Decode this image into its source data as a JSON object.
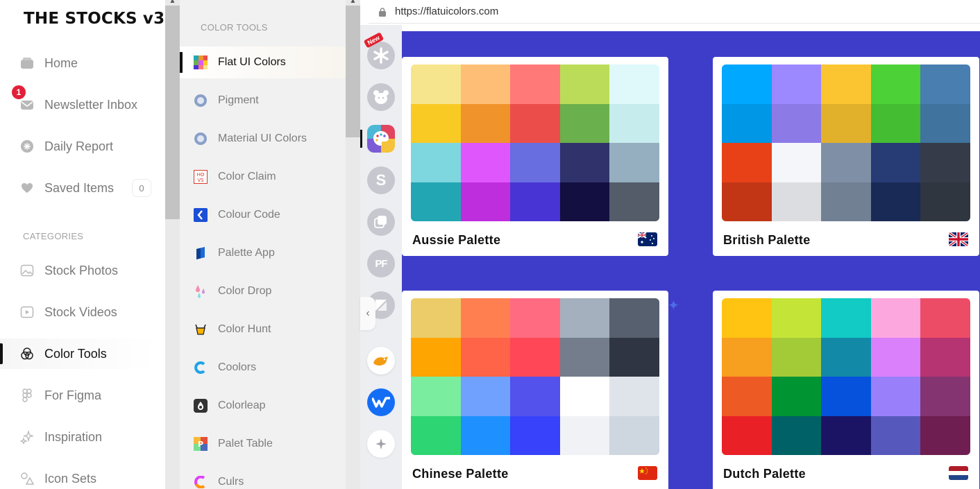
{
  "app": {
    "title": "THE STOCKS v3"
  },
  "sidebar": {
    "items": [
      {
        "label": "Home",
        "icon": "home-icon"
      },
      {
        "label": "Newsletter Inbox",
        "icon": "inbox-icon",
        "badge": "1"
      },
      {
        "label": "Daily Report",
        "icon": "report-icon"
      },
      {
        "label": "Saved Items",
        "icon": "heart-icon",
        "count": "0"
      }
    ],
    "categories_title": "CATEGORIES",
    "categories": [
      {
        "label": "Stock Photos",
        "icon": "photo-icon"
      },
      {
        "label": "Stock Videos",
        "icon": "video-icon"
      },
      {
        "label": "Color Tools",
        "icon": "palette-icon",
        "active": true
      },
      {
        "label": "For Figma",
        "icon": "figma-icon"
      },
      {
        "label": "Inspiration",
        "icon": "sparkle-icon"
      },
      {
        "label": "Icon Sets",
        "icon": "shapes-icon"
      }
    ]
  },
  "tools": {
    "title": "COLOR TOOLS",
    "items": [
      {
        "label": "Flat UI Colors",
        "active": true
      },
      {
        "label": "Pigment"
      },
      {
        "label": "Material UI Colors"
      },
      {
        "label": "Color Claim"
      },
      {
        "label": "Colour Code"
      },
      {
        "label": "Palette App"
      },
      {
        "label": "Color Drop"
      },
      {
        "label": "Color Hunt"
      },
      {
        "label": "Coolors"
      },
      {
        "label": "Colorleap"
      },
      {
        "label": "Palet Table"
      },
      {
        "label": "Culrs"
      }
    ]
  },
  "rail": {
    "new_tag": "New",
    "s_label": "S",
    "pf_label": "PF"
  },
  "browser": {
    "url": "https://flatuicolors.com"
  },
  "palettes": [
    {
      "name": "Aussie Palette",
      "flag": "australia-flag-icon",
      "colors": [
        "#f6e58d",
        "#ffbe76",
        "#ff7979",
        "#badc58",
        "#dff9fb",
        "#f9ca24",
        "#f0932b",
        "#eb4d4b",
        "#6ab04c",
        "#c7ecee",
        "#7ed6df",
        "#e056fd",
        "#686de0",
        "#30336b",
        "#95afc0",
        "#22a6b3",
        "#be2edd",
        "#4834d4",
        "#130f40",
        "#535c68"
      ]
    },
    {
      "name": "British Palette",
      "flag": "uk-flag-icon",
      "colors": [
        "#00a8ff",
        "#9c88ff",
        "#fbc531",
        "#4cd137",
        "#487eb0",
        "#0097e6",
        "#8c7ae6",
        "#e1b12c",
        "#44bd32",
        "#40739e",
        "#e84118",
        "#f5f6fa",
        "#7f8fa6",
        "#273c75",
        "#353b48",
        "#c23616",
        "#dcdde1",
        "#718093",
        "#192a56",
        "#2f3640"
      ]
    },
    {
      "name": "Chinese Palette",
      "flag": "china-flag-icon",
      "colors": [
        "#eccc68",
        "#ff7f50",
        "#ff6b81",
        "#a4b0be",
        "#57606f",
        "#ffa502",
        "#ff6348",
        "#ff4757",
        "#747d8c",
        "#2f3542",
        "#7bed9f",
        "#70a1ff",
        "#5352ed",
        "#ffffff",
        "#dfe4ea",
        "#2ed573",
        "#1e90ff",
        "#3742fa",
        "#f1f2f6",
        "#ced6e0"
      ]
    },
    {
      "name": "Dutch Palette",
      "flag": "netherlands-flag-icon",
      "colors": [
        "#ffc312",
        "#c4e538",
        "#12cbc4",
        "#fda7df",
        "#ed4c67",
        "#f79f1f",
        "#a3cb38",
        "#1289a7",
        "#d980fa",
        "#b53471",
        "#ee5a24",
        "#009432",
        "#0652dd",
        "#9980fa",
        "#833471",
        "#ea2027",
        "#006266",
        "#1b1464",
        "#5758bb",
        "#6f1e51"
      ]
    }
  ]
}
